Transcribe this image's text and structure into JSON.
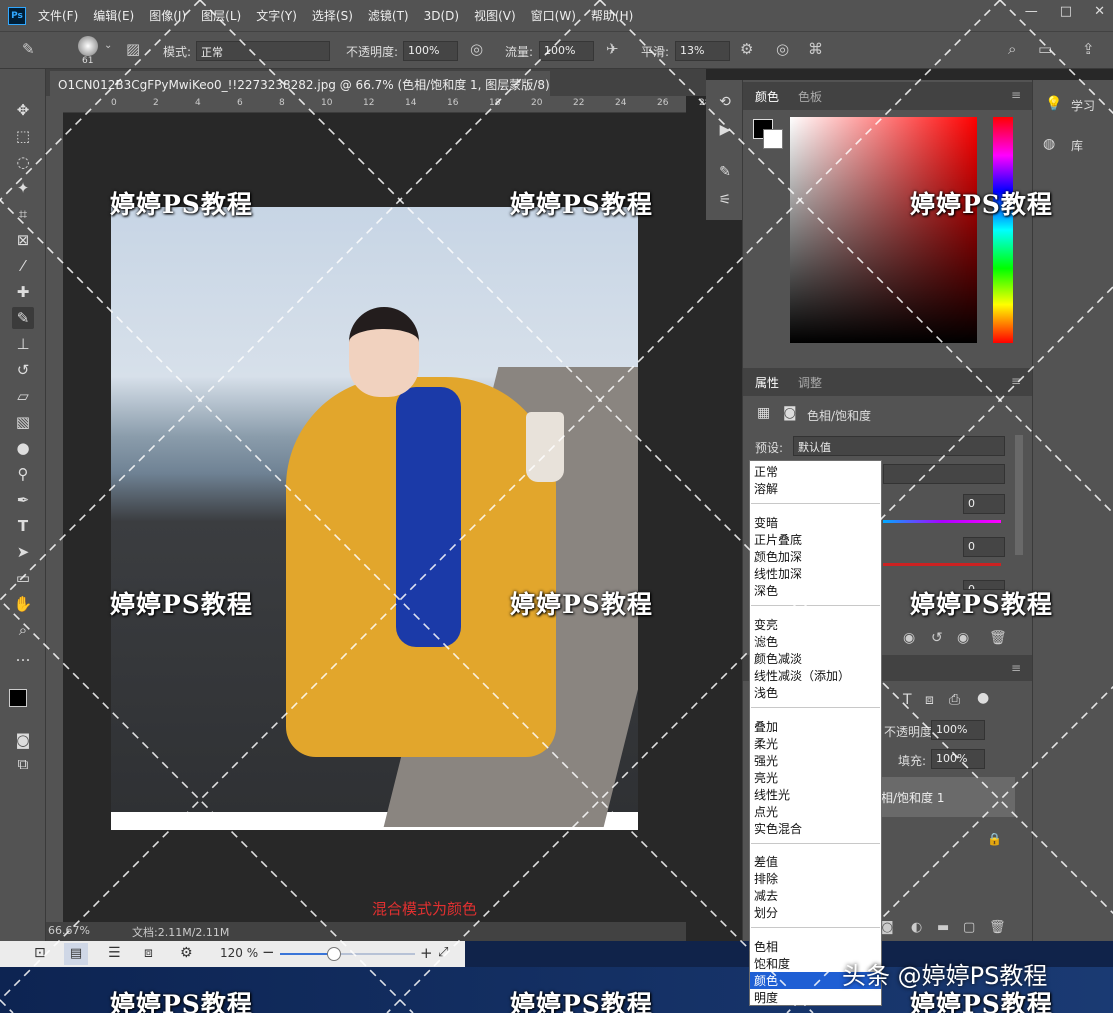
{
  "menu": {
    "logo": "Ps",
    "items": [
      "文件(F)",
      "编辑(E)",
      "图像(I)",
      "图层(L)",
      "文字(Y)",
      "选择(S)",
      "滤镜(T)",
      "3D(D)",
      "视图(V)",
      "窗口(W)",
      "帮助(H)"
    ],
    "window_controls": [
      "—",
      "□",
      "✕"
    ]
  },
  "options": {
    "brush_size": "61",
    "mode_label": "模式:",
    "mode_value": "正常",
    "opacity_label": "不透明度:",
    "opacity_value": "100%",
    "flow_label": "流量:",
    "flow_value": "100%",
    "smooth_label": "平滑:",
    "smooth_value": "13%"
  },
  "document": {
    "tab_title": "O1CN012B3CgFPyMwiKeo0_!!2273238282.jpg @ 66.7% (色相/饱和度 1, 图层蒙版/8) *",
    "tab_close": "×",
    "ruler_ticks": [
      "0",
      "2",
      "4",
      "6",
      "8",
      "10",
      "12",
      "14",
      "16",
      "18",
      "20",
      "22",
      "24",
      "26",
      "28"
    ],
    "zoom": "66.67%",
    "doc_size": "文档:2.11M/2.11M",
    "caption": "混合模式为颜色"
  },
  "navigator": {
    "zoom": "120 %",
    "slider_fraction": 0.4
  },
  "color_panel": {
    "tabs": [
      "颜色",
      "色板"
    ]
  },
  "properties": {
    "tabs": [
      "属性",
      "调整"
    ],
    "title": "色相/饱和度",
    "preset_label": "预设:",
    "preset_value": "默认值",
    "hue_value": "0",
    "saturation_value": "0",
    "lightness_value": "0"
  },
  "layers": {
    "opacity_label": "不透明度:",
    "opacity_value": "100%",
    "fill_label": "填充:",
    "fill_value": "100%",
    "layer_name": "相/饱和度 1"
  },
  "far_right": {
    "learn": "学习",
    "library": "库"
  },
  "blend_dropdown": {
    "groups": [
      [
        "正常",
        "溶解"
      ],
      [
        "变暗",
        "正片叠底",
        "颜色加深",
        "线性加深",
        "深色"
      ],
      [
        "变亮",
        "滤色",
        "颜色减淡",
        "线性减淡（添加）",
        "浅色"
      ],
      [
        "叠加",
        "柔光",
        "强光",
        "亮光",
        "线性光",
        "点光",
        "实色混合"
      ],
      [
        "差值",
        "排除",
        "减去",
        "划分"
      ],
      [
        "色相",
        "饱和度",
        "颜色",
        "明度"
      ]
    ],
    "selected": "颜色"
  },
  "watermark": "婷婷PS教程",
  "credit": "头条 @婷婷PS教程"
}
